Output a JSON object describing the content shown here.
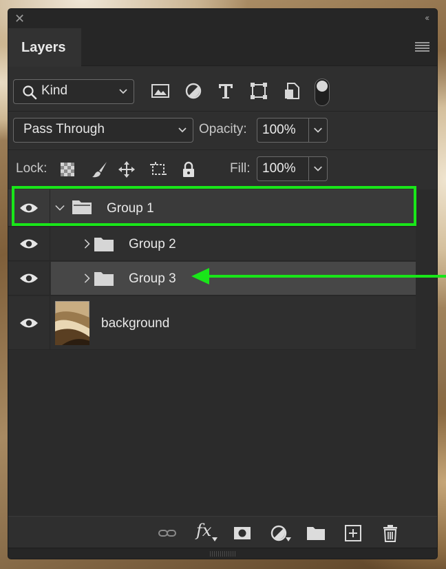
{
  "panel": {
    "close_glyph": "✕",
    "collapse_glyph": "‹‹",
    "tab_title": "Layers"
  },
  "filter": {
    "kind_label": "Kind",
    "icons": [
      "image-filter-icon",
      "adjustment-filter-icon",
      "type-filter-icon",
      "shape-filter-icon",
      "smart-object-filter-icon"
    ]
  },
  "blend": {
    "mode": "Pass Through",
    "opacity_label": "Opacity:",
    "opacity_value": "100%"
  },
  "lock": {
    "label": "Lock:",
    "fill_label": "Fill:",
    "fill_value": "100%"
  },
  "layers": [
    {
      "name": "Group 1",
      "type": "group",
      "expanded": true
    },
    {
      "name": "Group 2",
      "type": "group",
      "expanded": false
    },
    {
      "name": "Group 3",
      "type": "group",
      "expanded": false,
      "selected": true
    },
    {
      "name": "background",
      "type": "image"
    }
  ],
  "bottom": {
    "fx_label": "fx"
  },
  "annotation": {
    "highlight_color": "#19e619"
  }
}
